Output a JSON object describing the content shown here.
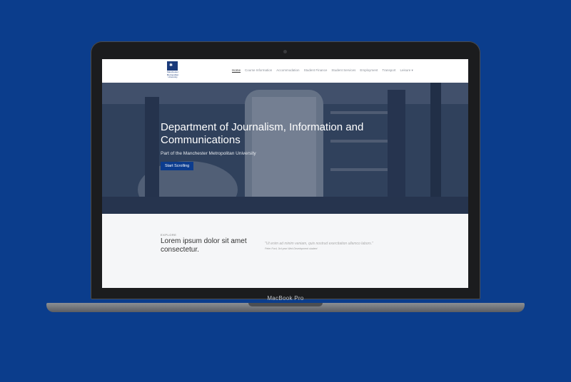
{
  "device": {
    "label": "MacBook Pro"
  },
  "site": {
    "logo": {
      "text": "Manchester Metropolitan University"
    },
    "nav": {
      "items": [
        "Home",
        "Course Information",
        "Accommodation",
        "Student Finance",
        "Student Services",
        "Employment",
        "Transport",
        "Leisure ▾"
      ],
      "active_index": 0
    },
    "hero": {
      "title": "Department of Journalism, Information and Communications",
      "subtitle": "Part of the Manchester Metropolitan University",
      "button": "Start Scrolling"
    },
    "content": {
      "eyebrow": "EXPLORE",
      "heading": "Lorem ipsum dolor sit amet consectetur.",
      "quote": "\"Ut enim ad minim veniam, quis nostrud exercitation ullamco labors.\"",
      "cite": "Peter Ford, 3rd year Web Development student"
    }
  },
  "colors": {
    "background": "#0b3d8c",
    "accent": "#0c3c8e"
  }
}
